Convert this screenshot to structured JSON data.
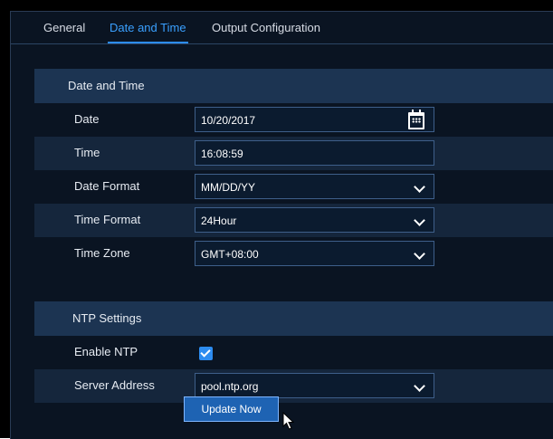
{
  "tabs": [
    {
      "label": "General"
    },
    {
      "label": "Date and Time",
      "active": true
    },
    {
      "label": "Output Configuration"
    }
  ],
  "date_time": {
    "header": "Date and Time",
    "date": {
      "label": "Date",
      "value": "10/20/2017"
    },
    "time": {
      "label": "Time",
      "value": "16:08:59"
    },
    "date_format": {
      "label": "Date Format",
      "value": "MM/DD/YY"
    },
    "time_format": {
      "label": "Time Format",
      "value": "24Hour"
    },
    "time_zone": {
      "label": "Time Zone",
      "value": "GMT+08:00"
    }
  },
  "ntp": {
    "header": "NTP Settings",
    "enable": {
      "label": "Enable NTP",
      "checked": true
    },
    "server": {
      "label": "Server Address",
      "value": "pool.ntp.org"
    },
    "update_button": "Update Now"
  },
  "colors": {
    "accent": "#2d8cf0",
    "background": "#0a1422",
    "section_header": "#1c3452",
    "row_shade": "#15263c"
  },
  "icons": [
    "calendar-icon",
    "chevron-down-icon",
    "checkmark-icon",
    "mouse-pointer-icon"
  ]
}
